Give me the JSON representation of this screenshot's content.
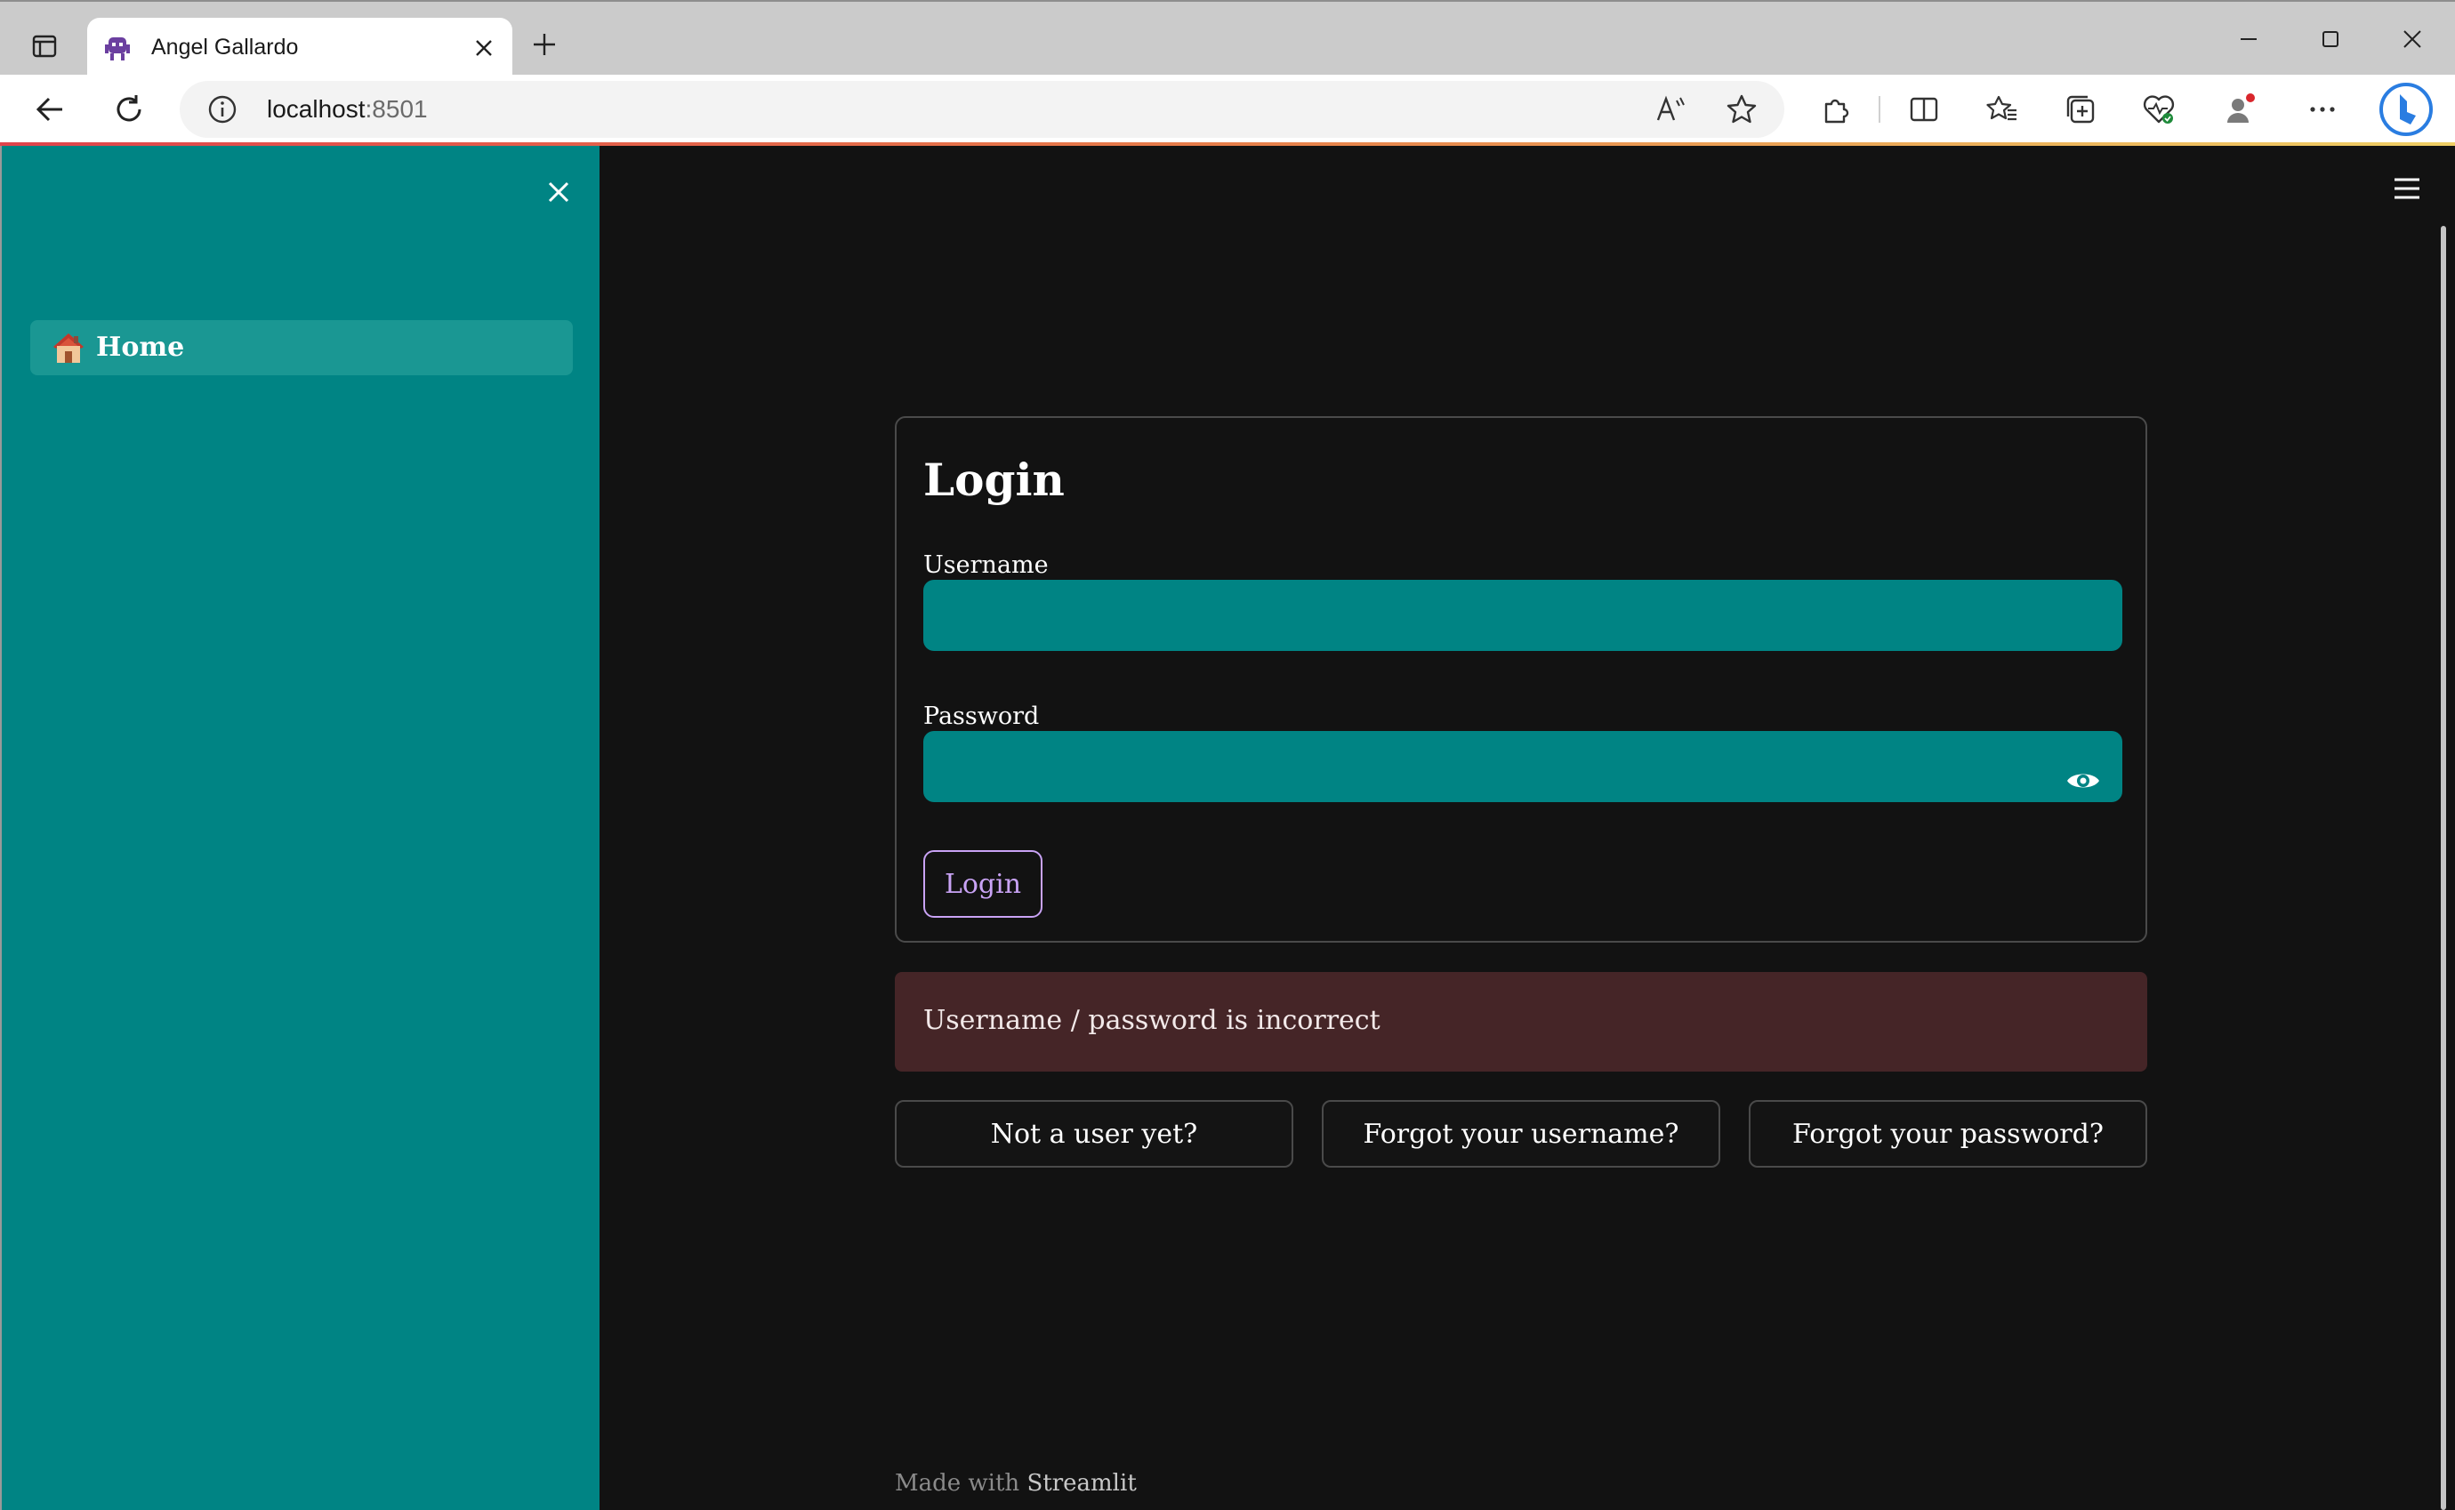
{
  "browser": {
    "tab_title": "Angel Gallardo",
    "url_host": "localhost",
    "url_port": ":8501",
    "icons": [
      "tab-actions-icon",
      "tab-favicon-icon",
      "close-tab-icon",
      "new-tab-icon",
      "minimize-icon",
      "maximize-icon",
      "close-window-icon",
      "back-icon",
      "refresh-icon",
      "info-icon",
      "read-aloud-icon",
      "favorite-star-icon",
      "extensions-icon",
      "split-screen-icon",
      "favorites-icon",
      "collections-icon",
      "browser-essentials-icon",
      "profile-icon",
      "more-icon",
      "bing-copilot-icon"
    ]
  },
  "sidebar": {
    "items": [
      {
        "label": "Home",
        "icon": "house-icon"
      }
    ]
  },
  "login": {
    "title": "Login",
    "username_label": "Username",
    "username_value": "",
    "password_label": "Password",
    "password_value": "",
    "submit_label": "Login"
  },
  "error": {
    "message": "Username / password is incorrect"
  },
  "actions": {
    "register_label": "Not a user yet?",
    "forgot_username_label": "Forgot your username?",
    "forgot_password_label": "Forgot your password?"
  },
  "footer": {
    "prefix": "Made with",
    "brand": "Streamlit"
  },
  "colors": {
    "sidebar_bg": "#008484",
    "main_bg": "#121212",
    "input_bg": "#008484",
    "primary_accent": "#c9a3f5",
    "error_bg": "#452527"
  }
}
